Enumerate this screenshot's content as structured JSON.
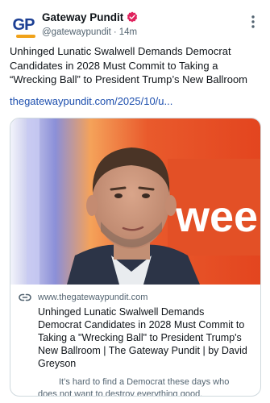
{
  "account": {
    "display_name": "Gateway Pundit",
    "handle": "@gatewaypundit",
    "separator": "·",
    "time": "14m",
    "avatar_text": "GP",
    "verified": true,
    "badge_color": "#e0245e"
  },
  "post": {
    "text": "Unhinged Lunatic Swalwell Demands Democrat Candidates in 2028 Must Commit to Taking a “Wrecking Ball” to President Trump’s New Ballroom",
    "link": "thegatewaypundit.com/2025/10/u..."
  },
  "card": {
    "domain": "www.thegatewaypundit.com",
    "title": "Unhinged Lunatic Swalwell Demands Democrat Candidates in 2028 Must Commit to Taking a \"Wrecking Ball\" to President Trump's New Ballroom | The Gateway Pundit | by David Greyson",
    "description": "It’s hard to find a Democrat these days who does not want to destroy everything good.",
    "image_overlay_text": "weel"
  },
  "colors": {
    "link": "#1d4fae",
    "secondary_text": "#536471",
    "border": "#cfd9de",
    "backdrop_orange": "#e8502a"
  }
}
